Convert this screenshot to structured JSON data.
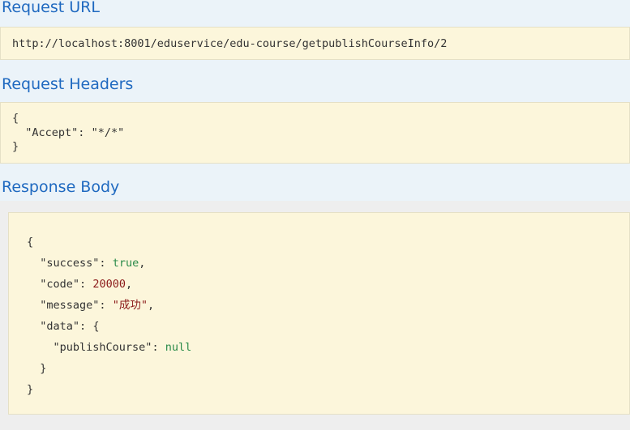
{
  "request_url": {
    "title": "Request URL",
    "value": "http://localhost:8001/eduservice/edu-course/getpublishCourseInfo/2"
  },
  "request_headers": {
    "title": "Request Headers",
    "open": "{",
    "key": "\"Accept\"",
    "colon": ": ",
    "value": "\"*/*\"",
    "close": "}"
  },
  "response_body": {
    "title": "Response Body",
    "open": "{",
    "success_key": "\"success\"",
    "success_value": "true",
    "code_key": "\"code\"",
    "code_value": "20000",
    "message_key": "\"message\"",
    "message_value": "\"成功\"",
    "data_key": "\"data\"",
    "data_open": "{",
    "publish_key": "\"publishCourse\"",
    "publish_value": "null",
    "data_close": "}",
    "close": "}"
  }
}
